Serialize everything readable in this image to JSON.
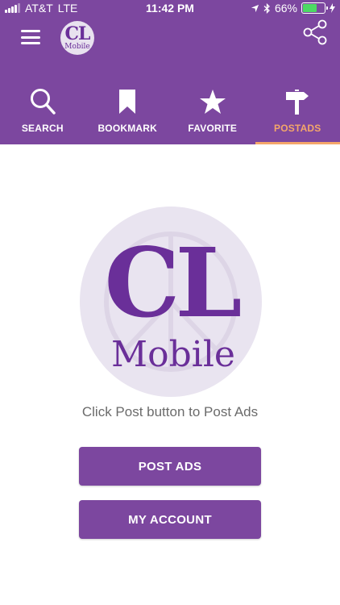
{
  "status_bar": {
    "carrier": "AT&T",
    "network": "LTE",
    "time": "11:42 PM",
    "battery_percent": "66%",
    "battery_level": 0.66
  },
  "header": {
    "logo_line1": "CL",
    "logo_line2": "Mobile"
  },
  "tabs": [
    {
      "label": "SEARCH",
      "icon": "search-icon"
    },
    {
      "label": "BOOKMARK",
      "icon": "bookmark-icon"
    },
    {
      "label": "FAVORITE",
      "icon": "star-icon"
    },
    {
      "label": "POSTADS",
      "icon": "signpost-icon",
      "active": true
    }
  ],
  "main": {
    "logo_line1": "CL",
    "logo_line2": "Mobile",
    "hint": "Click Post button to Post Ads",
    "post_button": "POST ADS",
    "account_button": "MY ACCOUNT"
  },
  "colors": {
    "brand": "#7c479f",
    "active_tab": "#f4a66a",
    "battery": "#4cd964"
  }
}
